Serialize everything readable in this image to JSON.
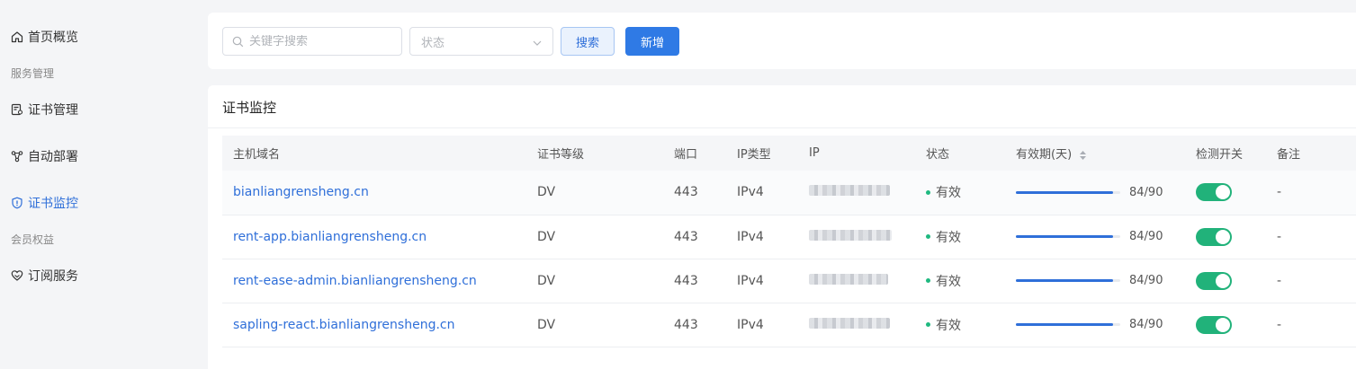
{
  "sidebar": {
    "items": [
      {
        "label": "首页概览"
      },
      {
        "group": "服务管理"
      },
      {
        "label": "证书管理"
      },
      {
        "label": "自动部署"
      },
      {
        "label": "证书监控",
        "active": true
      },
      {
        "group": "会员权益"
      },
      {
        "label": "订阅服务"
      }
    ]
  },
  "toolbar": {
    "search_placeholder": "关键字搜索",
    "status_placeholder": "状态",
    "search_label": "搜索",
    "add_label": "新增"
  },
  "main": {
    "title": "证书监控",
    "columns": [
      "主机域名",
      "证书等级",
      "端口",
      "IP类型",
      "IP",
      "状态",
      "有效期(天)",
      "检测开关",
      "备注"
    ],
    "rows": [
      {
        "host": "bianliangrensheng.cn",
        "level": "DV",
        "port": "443",
        "ip_type": "IPv4",
        "status": "有效",
        "validity_text": "84/90",
        "validity_fraction": 0.933,
        "switch_on": true,
        "remark": "-"
      },
      {
        "host": "rent-app.bianliangrensheng.cn",
        "level": "DV",
        "port": "443",
        "ip_type": "IPv4",
        "status": "有效",
        "validity_text": "84/90",
        "validity_fraction": 0.933,
        "switch_on": true,
        "remark": "-"
      },
      {
        "host": "rent-ease-admin.bianliangrensheng.cn",
        "level": "DV",
        "port": "443",
        "ip_type": "IPv4",
        "status": "有效",
        "validity_text": "84/90",
        "validity_fraction": 0.933,
        "switch_on": true,
        "remark": "-"
      },
      {
        "host": "sapling-react.bianliangrensheng.cn",
        "level": "DV",
        "port": "443",
        "ip_type": "IPv4",
        "status": "有效",
        "validity_text": "84/90",
        "validity_fraction": 0.933,
        "switch_on": true,
        "remark": "-"
      }
    ]
  },
  "colors": {
    "accent": "#2f6fd9",
    "success": "#21b27a"
  }
}
